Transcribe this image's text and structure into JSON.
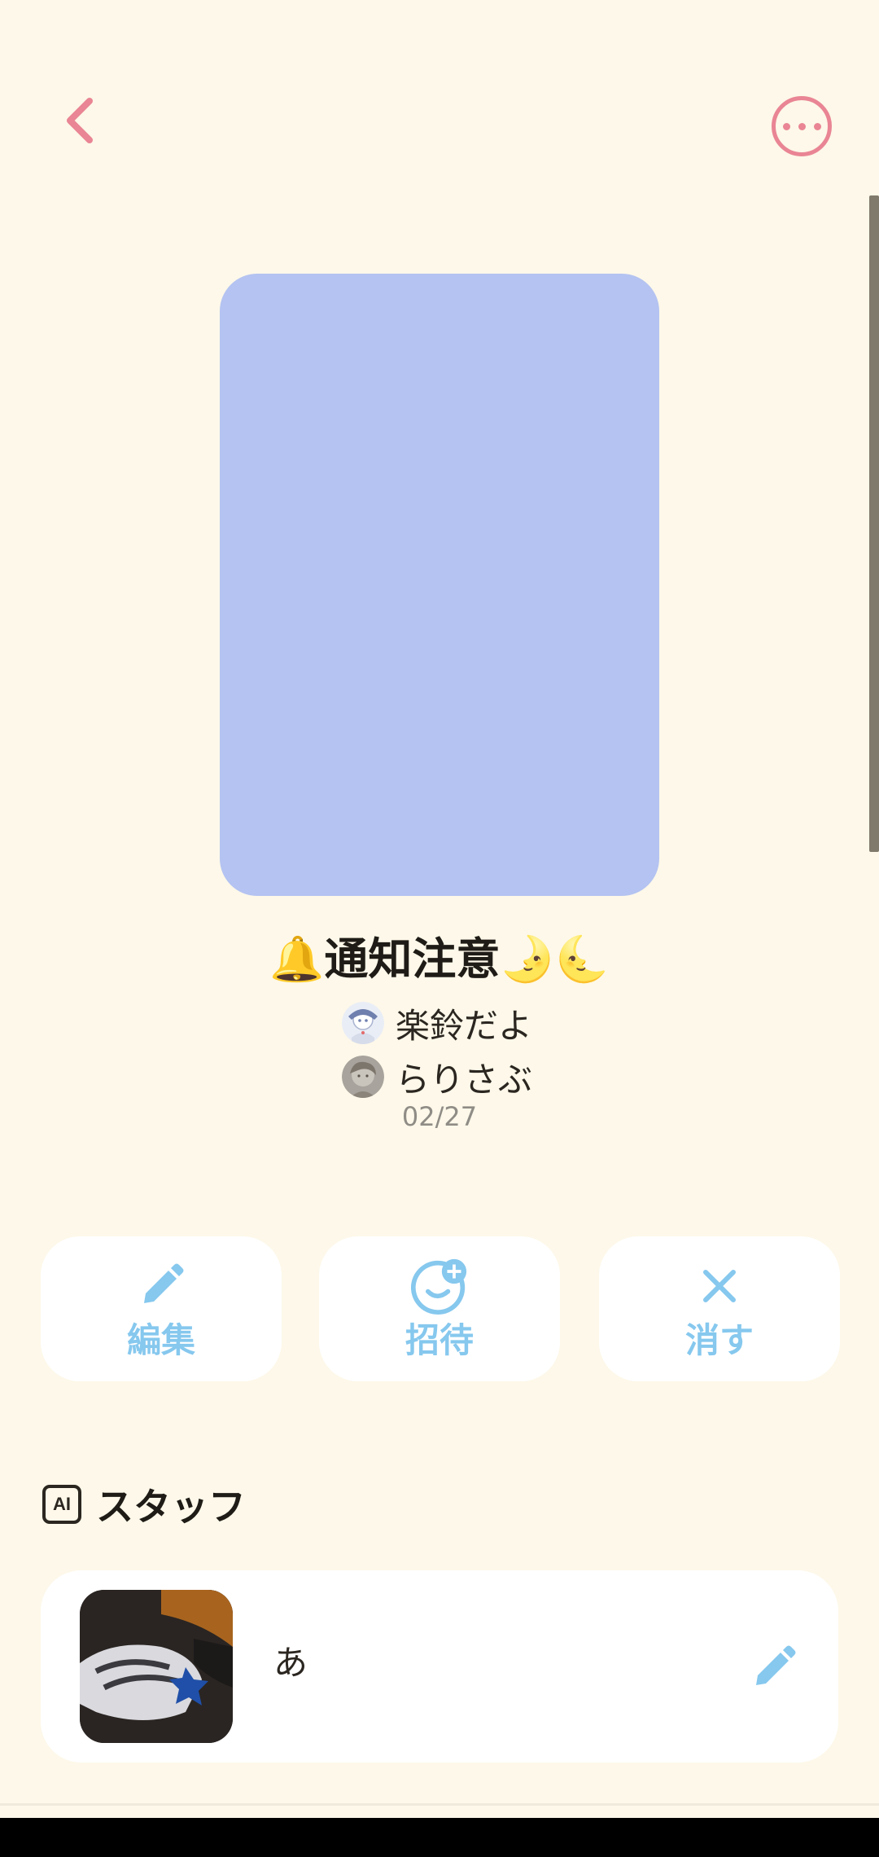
{
  "header": {
    "back_icon": "chevron-left-icon",
    "more_icon": "more-horizontal-icon",
    "accent_color": "#e98594"
  },
  "cover": {
    "color": "#b4c3f1"
  },
  "room": {
    "title": "🔔通知注意🌛🌜",
    "members": [
      {
        "name": "楽鈴だよ"
      },
      {
        "name": "らりさぶ"
      }
    ],
    "date": "02/27"
  },
  "actions": [
    {
      "label": "編集",
      "icon": "pencil-icon"
    },
    {
      "label": "招待",
      "icon": "add-friend-icon"
    },
    {
      "label": "消す",
      "icon": "close-icon"
    }
  ],
  "staff_section": {
    "badge": "AI",
    "title": "スタッフ",
    "item": {
      "name": "あ",
      "edit_icon": "pencil-icon"
    }
  },
  "colors": {
    "background": "#fdf8e9",
    "action_text": "#86c8ee",
    "card": "#ffffff"
  }
}
